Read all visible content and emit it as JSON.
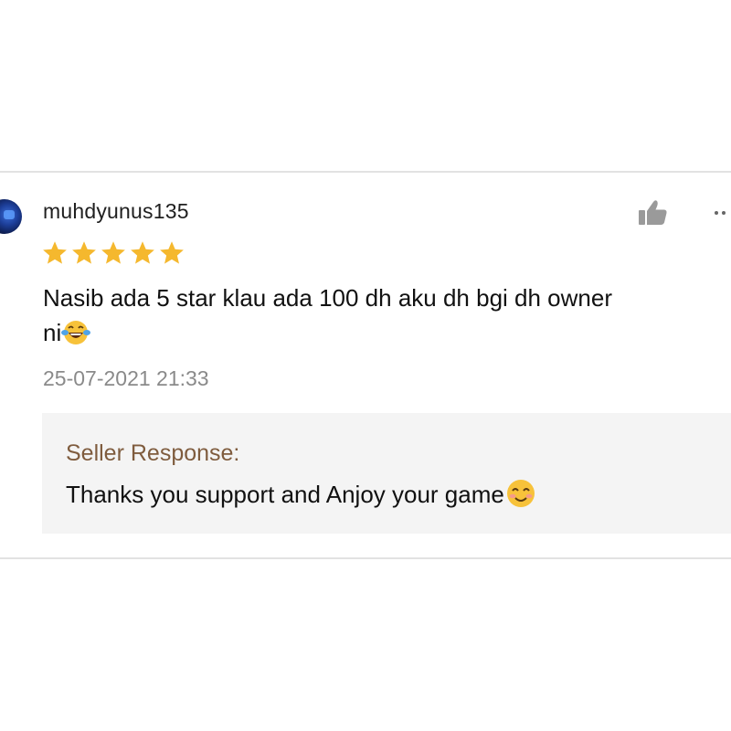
{
  "review": {
    "username": "muhdyunus135",
    "rating": 5,
    "comment_line1": "Nasib ada 5 star klau ada 100 dh aku dh bgi dh owner",
    "comment_line2": "ni",
    "comment_emoji": "face-with-tears-of-joy-icon",
    "timestamp": "25-07-2021 21:33"
  },
  "seller_response": {
    "title": "Seller Response:",
    "text": "Thanks you support and Anjoy your game",
    "emoji": "smiling-face-icon"
  },
  "colors": {
    "star": "#f5b82e",
    "response_title": "#7f5c3e",
    "timestamp": "#8a8a8a",
    "response_bg": "#f4f4f4"
  }
}
